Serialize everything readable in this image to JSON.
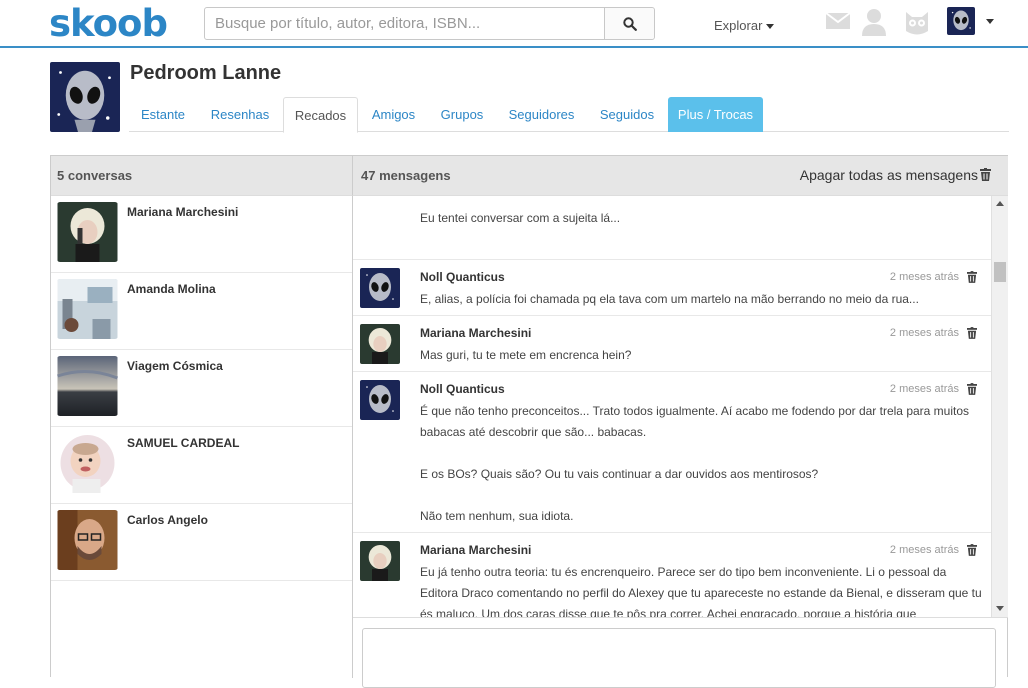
{
  "brand": {
    "logo": "skoob"
  },
  "search": {
    "placeholder": "Busque por título, autor, editora, ISBN...",
    "value": ""
  },
  "nav": {
    "explore_label": "Explorar"
  },
  "topbar_icons": [
    "mail-icon",
    "person-icon",
    "owl-icon"
  ],
  "profile": {
    "name": "Pedroom Lanne"
  },
  "tabs": [
    {
      "label": "Estante"
    },
    {
      "label": "Resenhas"
    },
    {
      "label": "Recados"
    },
    {
      "label": "Amigos"
    },
    {
      "label": "Grupos"
    },
    {
      "label": "Seguidores"
    },
    {
      "label": "Seguidos"
    },
    {
      "label": "Plus / Trocas"
    }
  ],
  "active_tab": "Recados",
  "conversations": {
    "header": "5 conversas",
    "items": [
      {
        "name": "Mariana Marchesini"
      },
      {
        "name": "Amanda Molina"
      },
      {
        "name": "Viagem Cósmica"
      },
      {
        "name": "SAMUEL CARDEAL"
      },
      {
        "name": "Carlos Angelo"
      }
    ]
  },
  "messages": {
    "header": "47 mensagens",
    "delete_all_label": "Apagar todas as mensagens",
    "items": [
      {
        "author": "",
        "time": "",
        "text": "carro. Conversamos e ficou tudo bem. Hoje nos cruzamos no elevador e trocamos idéias numa boa.\n\nEu tentei conversar com a sujeita lá..."
      },
      {
        "author": "Noll Quanticus",
        "time": "2 meses atrás",
        "text": "E, alias, a polícia foi chamada pq ela tava com um martelo na mão berrando no meio da rua..."
      },
      {
        "author": "Mariana Marchesini",
        "time": "2 meses atrás",
        "text": "Mas guri, tu te mete em encrenca hein?"
      },
      {
        "author": "Noll Quanticus",
        "time": "2 meses atrás",
        "text": "É que não tenho preconceitos... Trato todos igualmente. Aí acabo me fodendo por dar trela para muitos babacas até descobrir que são... babacas.\n\nE os BOs? Quais são? Ou tu vais continuar a dar ouvidos aos mentirosos?\n\nNão tem nenhum, sua idiota."
      },
      {
        "author": "Mariana Marchesini",
        "time": "2 meses atrás",
        "text": "Eu já tenho outra teoria: tu és encrenqueiro. Parece ser do tipo bem inconveniente. Li o pessoal da Editora Draco comentando no perfil do Alexey que tu apareceste no estande da Bienal, e disseram que tu és maluco. Um dos caras disse que te pôs pra correr. Achei engraçado, porque a história que"
      }
    ]
  },
  "colors": {
    "brand": "#2c86c6",
    "plus_tab": "#5bc0eb",
    "header_bg": "#e6e6e6"
  }
}
